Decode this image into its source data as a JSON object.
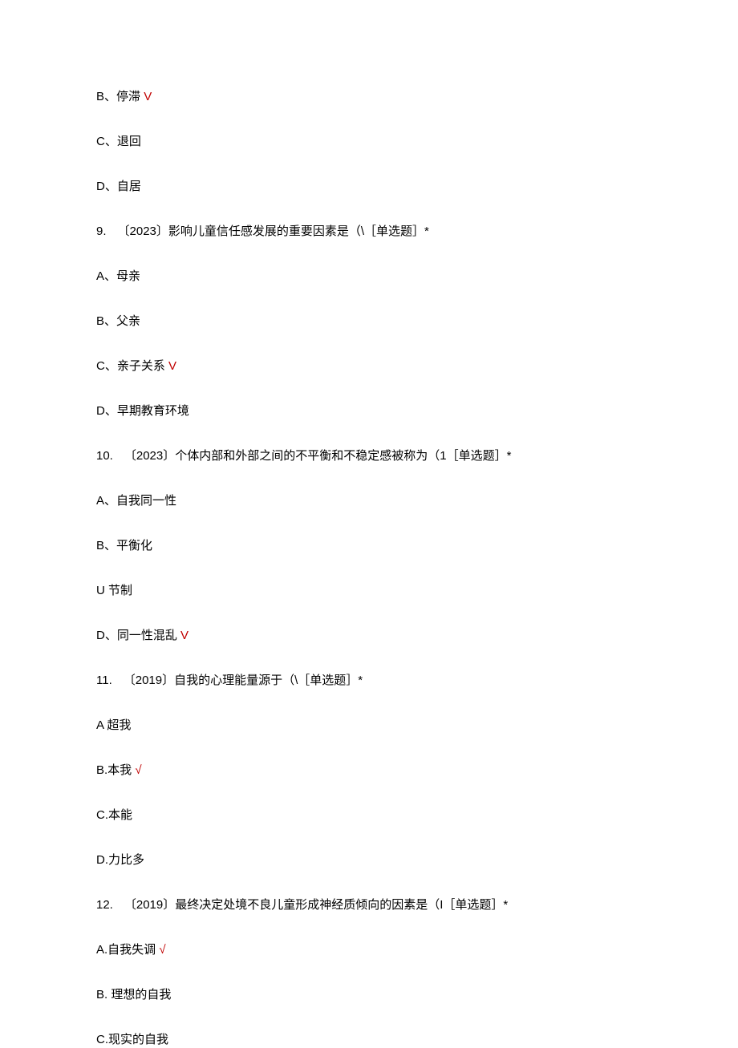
{
  "lines": [
    {
      "parts": [
        {
          "t": "B、停滞 "
        },
        {
          "t": "V",
          "correct": true
        }
      ]
    },
    {
      "parts": [
        {
          "t": "C、退回"
        }
      ]
    },
    {
      "parts": [
        {
          "t": "D、自居"
        }
      ]
    },
    {
      "parts": [
        {
          "t": "9.",
          "num": true
        },
        {
          "t": "〔2023〕影响儿童信任感发展的重要因素是（\\［单选题］*"
        }
      ]
    },
    {
      "parts": [
        {
          "t": "A、母亲"
        }
      ]
    },
    {
      "parts": [
        {
          "t": "B、父亲"
        }
      ]
    },
    {
      "parts": [
        {
          "t": "C、亲子关系 "
        },
        {
          "t": "V",
          "correct": true
        }
      ]
    },
    {
      "parts": [
        {
          "t": "D、早期教育环境"
        }
      ]
    },
    {
      "parts": [
        {
          "t": "10.",
          "num": true
        },
        {
          "t": "〔2023〕个体内部和外部之间的不平衡和不稳定感被称为（1［单选题］*"
        }
      ]
    },
    {
      "parts": [
        {
          "t": "A、自我同一性"
        }
      ]
    },
    {
      "parts": [
        {
          "t": "B、平衡化"
        }
      ]
    },
    {
      "parts": [
        {
          "t": "U 节制"
        }
      ]
    },
    {
      "parts": [
        {
          "t": "D、同一性混乱 "
        },
        {
          "t": "V",
          "correct": true
        }
      ]
    },
    {
      "parts": [
        {
          "t": "11.",
          "num": true
        },
        {
          "t": "〔2019〕自我的心理能量源于（\\［单选题］*"
        }
      ]
    },
    {
      "parts": [
        {
          "t": "A 超我"
        }
      ]
    },
    {
      "parts": [
        {
          "t": "B.本我 "
        },
        {
          "t": "√",
          "correct": true
        }
      ]
    },
    {
      "parts": [
        {
          "t": "C.本能"
        }
      ]
    },
    {
      "parts": [
        {
          "t": "D.力比多"
        }
      ]
    },
    {
      "parts": [
        {
          "t": "12.",
          "num": true
        },
        {
          "t": "〔2019〕最终决定处境不良儿童形成神经质倾向的因素是（I［单选题］*"
        }
      ]
    },
    {
      "parts": [
        {
          "t": "A.自我失调 "
        },
        {
          "t": "√",
          "correct": true
        }
      ]
    },
    {
      "parts": [
        {
          "t": "B. 理想的自我"
        }
      ]
    },
    {
      "parts": [
        {
          "t": "C.现实的自我"
        }
      ]
    }
  ]
}
